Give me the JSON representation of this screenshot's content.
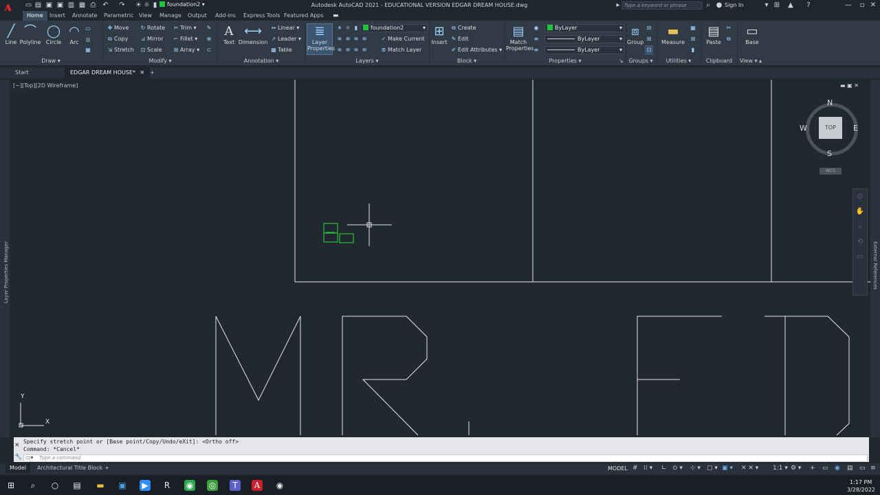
{
  "titlebar": {
    "layer_name": "foundation2",
    "window_title": "Autodesk AutoCAD 2021 - EDUCATIONAL VERSION   EDGAR DREAM HOUSE.dwg",
    "search_placeholder": "Type a keyword or phrase",
    "sign_in": "Sign In"
  },
  "ribbon_tabs": [
    "Home",
    "Insert",
    "Annotate",
    "Parametric",
    "View",
    "Manage",
    "Output",
    "Add-ins",
    "Express Tools",
    "Featured Apps"
  ],
  "draw": {
    "line": "Line",
    "polyline": "Polyline",
    "circle": "Circle",
    "arc": "Arc",
    "title": "Draw"
  },
  "modify": {
    "move": "Move",
    "rotate": "Rotate",
    "trim": "Trim",
    "copy": "Copy",
    "mirror": "Mirror",
    "fillet": "Fillet",
    "stretch": "Stretch",
    "scale": "Scale",
    "array": "Array",
    "title": "Modify"
  },
  "annotation": {
    "text": "Text",
    "dimension": "Dimension",
    "linear": "Linear",
    "leader": "Leader",
    "table": "Table",
    "title": "Annotation"
  },
  "layers": {
    "layer_properties_1": "Layer",
    "layer_properties_2": "Properties",
    "current_layer": "foundation2",
    "make_current": "Make Current",
    "match_layer": "Match Layer",
    "title": "Layers"
  },
  "block": {
    "insert": "Insert",
    "create": "Create",
    "edit": "Edit",
    "edit_attributes": "Edit Attributes",
    "title": "Block"
  },
  "properties": {
    "match_1": "Match",
    "match_2": "Properties",
    "color": "ByLayer",
    "linetype": "ByLayer",
    "lineweight": "ByLayer",
    "title": "Properties"
  },
  "groups": {
    "group": "Group",
    "title": "Groups"
  },
  "utilities": {
    "measure": "Measure",
    "title": "Utilities"
  },
  "clipboard": {
    "paste": "Paste",
    "title": "Clipboard"
  },
  "view_panel": {
    "base": "Base",
    "title": "View"
  },
  "filetabs": {
    "start": "Start",
    "drawing": "EDGAR DREAM HOUSE*"
  },
  "viewport": {
    "label": "[−][Top][2D Wireframe]"
  },
  "viewcube": {
    "face": "TOP",
    "north": "N",
    "south": "S",
    "east": "E",
    "west": "W",
    "wcs": "WCS"
  },
  "side_panels": {
    "left": "Layer Properties Manager",
    "right": "External References"
  },
  "ucs": {
    "x": "X",
    "y": "Y"
  },
  "command": {
    "history_1": "Specify stretch point or [Base point/Copy/Undo/eXit]:  <Ortho off>",
    "history_2": "Command: *Cancel*",
    "placeholder": "Type a command"
  },
  "layout_tabs": [
    "Model",
    "Architectural Title Block"
  ],
  "status": {
    "model": "MODEL"
  },
  "clock": {
    "time": "1:17 PM",
    "date": "3/28/2022"
  },
  "colors": {
    "accent": "#3b4a5a",
    "layer_green": "#23c23a",
    "drawing_bg": "#212830"
  }
}
